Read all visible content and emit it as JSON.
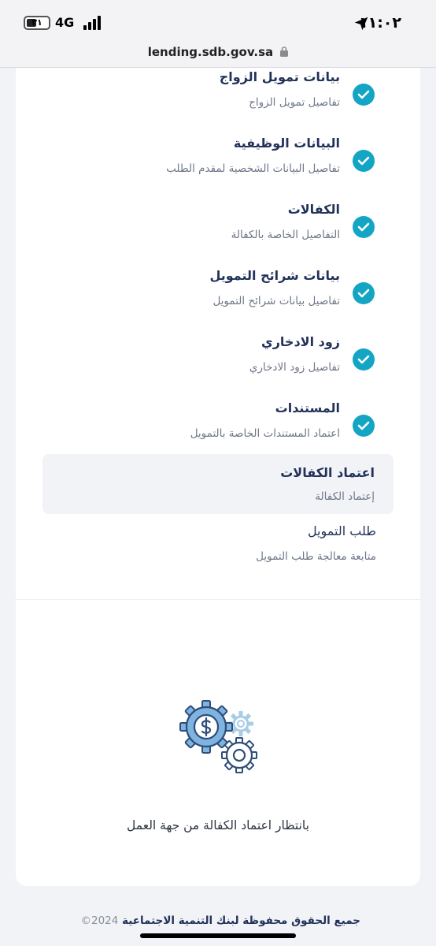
{
  "status_bar": {
    "time": "١١:٠٢",
    "network": "4G",
    "battery": "٣١"
  },
  "browser": {
    "url": "lending.sdb.gov.sa"
  },
  "steps": [
    {
      "title": "بيانات تمويل الزواج",
      "subtitle": "تفاصيل تمويل الزواج",
      "status": "completed"
    },
    {
      "title": "البيانات الوظيفية",
      "subtitle": "تفاصيل البيانات الشخصية لمقدم الطلب",
      "status": "completed"
    },
    {
      "title": "الكفالات",
      "subtitle": "التفاصيل الخاصة بالكفالة",
      "status": "completed"
    },
    {
      "title": "بيانات شرائح التمويل",
      "subtitle": "تفاصيل بيانات شرائح التمويل",
      "status": "completed"
    },
    {
      "title": "زود الادخاري",
      "subtitle": "تفاصيل زود الادخاري",
      "status": "completed"
    },
    {
      "title": "المستندات",
      "subtitle": "اعتماد المستندات الخاصة بالتمويل",
      "status": "completed"
    },
    {
      "title": "اعتماد الكفالات",
      "subtitle": "إعتماد الكفالة",
      "status": "active"
    },
    {
      "title": "طلب التمويل",
      "subtitle": "متابعة معالجة طلب التمويل",
      "status": "pending"
    }
  ],
  "waiting_message": "بانتظار اعتماد الكفالة من جهة العمل",
  "footer": {
    "rights": "جميع الحقوق محفوظة لبنك التنمية الاجتماعية",
    "year": "2024©"
  },
  "colors": {
    "accent": "#13a5c3",
    "navy": "#22325a"
  }
}
